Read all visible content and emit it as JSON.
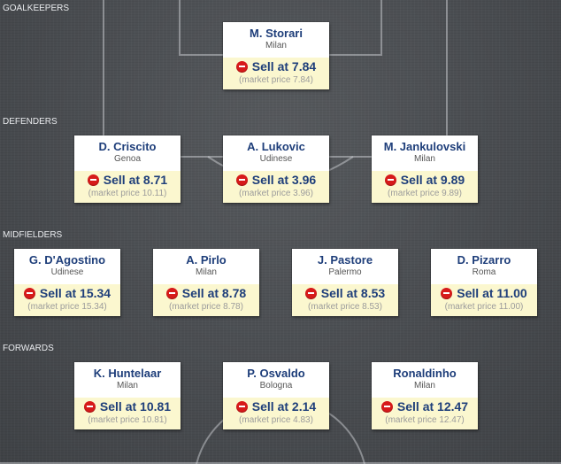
{
  "sections": {
    "goalkeepers": "GOALKEEPERS",
    "defenders": "DEFENDERS",
    "midfielders": "MIDFIELDERS",
    "forwards": "FORWARDS"
  },
  "players": {
    "gk1": {
      "name": "M. Storari",
      "club": "Milan",
      "sell": "Sell at 7.84",
      "market": "(market price 7.84)"
    },
    "def1": {
      "name": "D. Criscito",
      "club": "Genoa",
      "sell": "Sell at 8.71",
      "market": "(market price 10.11)"
    },
    "def2": {
      "name": "A. Lukovic",
      "club": "Udinese",
      "sell": "Sell at 3.96",
      "market": "(market price 3.96)"
    },
    "def3": {
      "name": "M. Jankulovski",
      "club": "Milan",
      "sell": "Sell at 9.89",
      "market": "(market price 9.89)"
    },
    "mid1": {
      "name": "G. D'Agostino",
      "club": "Udinese",
      "sell": "Sell at 15.34",
      "market": "(market price 15.34)"
    },
    "mid2": {
      "name": "A. Pirlo",
      "club": "Milan",
      "sell": "Sell at 8.78",
      "market": "(market price 8.78)"
    },
    "mid3": {
      "name": "J. Pastore",
      "club": "Palermo",
      "sell": "Sell at 8.53",
      "market": "(market price 8.53)"
    },
    "mid4": {
      "name": "D. Pizarro",
      "club": "Roma",
      "sell": "Sell at 11.00",
      "market": "(market price 11.00)"
    },
    "fwd1": {
      "name": "K. Huntelaar",
      "club": "Milan",
      "sell": "Sell at 10.81",
      "market": "(market price 10.81)"
    },
    "fwd2": {
      "name": "P. Osvaldo",
      "club": "Bologna",
      "sell": "Sell at 2.14",
      "market": "(market price 4.83)"
    },
    "fwd3": {
      "name": "Ronaldinho",
      "club": "Milan",
      "sell": "Sell at 12.47",
      "market": "(market price 12.47)"
    }
  },
  "icons": {
    "sell": "minus-circle-icon"
  },
  "colors": {
    "accent": "#1e3e7a",
    "sell_bg": "#fbf7cf",
    "minus": "#d71a1a",
    "board": "#4b4e52"
  }
}
